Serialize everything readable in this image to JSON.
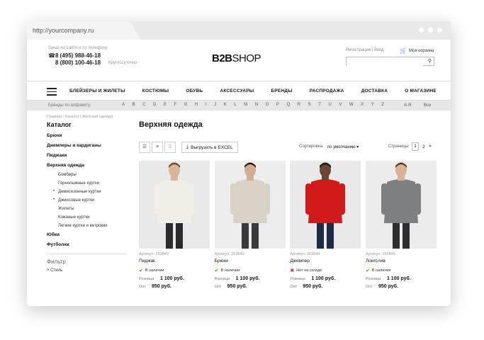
{
  "browser": {
    "url": "http://yourcompany.ru"
  },
  "header": {
    "order_note": "Заказ на сайте и по телефону",
    "phone1": "8 (495) 988-46-18",
    "phone2": "8 (800) 100-46-18",
    "phone_note": "Круглосуточно",
    "logo_bold": "B2B",
    "logo_light": "SHOP",
    "register": "Регистрация | Вход",
    "cart": "Моя корзина",
    "search_placeholder": ""
  },
  "nav": {
    "items": [
      "БЛЕЙЗЕРЫ И ЖИЛЕТЫ",
      "КОСТЮМЫ",
      "ОБУВЬ",
      "АКСЕССУАРЫ",
      "БРЕНДЫ",
      "РАСПРОДАЖА",
      "ДОСТАВКА",
      "О МАГАЗИНЕ"
    ]
  },
  "alphabet": {
    "label": "Бренды по алфавиту:",
    "letters": [
      "A",
      "B",
      "C",
      "D",
      "E",
      "F",
      "G",
      "H",
      "I",
      "J",
      "K",
      "L",
      "M",
      "N",
      "O",
      "P",
      "Q",
      "R",
      "S",
      "T",
      "U",
      "V",
      "W",
      "X",
      "Y",
      "Z"
    ],
    "range": "А-Я",
    "all": "Все"
  },
  "sidebar": {
    "breadcrumb": "Главная / Каталог / Женская одежда",
    "title": "Каталог",
    "items": [
      "Брюки",
      "Джемперы и кардиганы",
      "Пиджаки",
      "Верхняя одежда"
    ],
    "subitems": [
      "Бомберы",
      "Горнолыжные куртки",
      "Демисезонные куртки",
      "Джинсовые куртки",
      "Жилеты",
      "Кожаные куртки",
      "Легкие куртки и ветровки"
    ],
    "items_after": [
      "Юбки",
      "Футболки"
    ],
    "filter_title": "Фильтр",
    "filter_style": "Стиль"
  },
  "main": {
    "title": "Верхняя одежда",
    "export": "Выгрузить в EXCEL",
    "sort_label": "Сортировка:",
    "sort_value": "по умолчанию",
    "pages_label": "Страницы:",
    "page_current": "1",
    "page_next_num": "2"
  },
  "products": [
    {
      "art": "Артикул: 263849",
      "name": "Пиджак",
      "avail": "В наличии",
      "in_stock": true,
      "retail_label": "Розница",
      "retail": "1 100 руб.",
      "opt_label": "Опт",
      "opt": "950 руб."
    },
    {
      "art": "Артикул: 263849",
      "name": "Брюки",
      "avail": "В наличии",
      "in_stock": true,
      "retail_label": "Розница",
      "retail": "1 100 руб.",
      "opt_label": "Опт",
      "opt": "950 руб."
    },
    {
      "art": "Артикул: 263849",
      "name": "Джемпер",
      "avail": "Нет на складе",
      "in_stock": false,
      "retail_label": "Розница",
      "retail": "1 100 руб.",
      "opt_label": "Опт",
      "opt": "950 руб."
    },
    {
      "art": "Артикул: 263849",
      "name": "Лонгслив",
      "avail": "В наличии",
      "in_stock": true,
      "retail_label": "Розница",
      "retail": "1 100 руб.",
      "opt_label": "Опт",
      "opt": "950 руб."
    }
  ],
  "colors": {
    "in_stock": "#2a9d3a",
    "out_of_stock": "#d32222"
  }
}
